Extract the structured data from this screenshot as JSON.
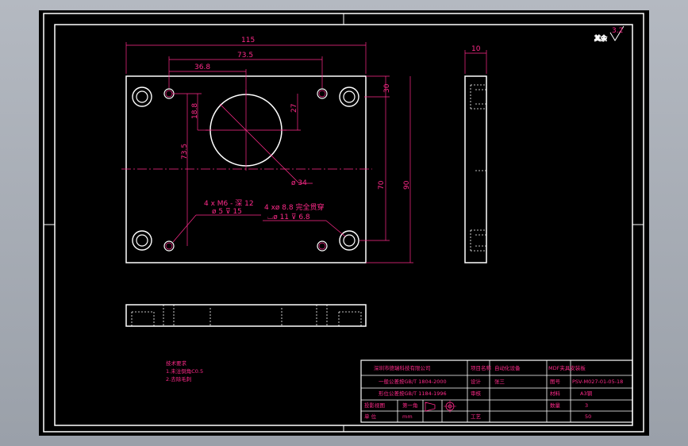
{
  "drawing": {
    "dims": {
      "d115": "115",
      "d735": "73.5",
      "d368": "36.8",
      "d30": "30",
      "d27": "27",
      "d188": "18.8",
      "d735v": "73.5",
      "d70": "70",
      "d90": "90",
      "d10": "10",
      "phi34": "ø 34"
    },
    "callouts": {
      "thread_a": "4 x  M6 - 深 12",
      "thread_b": "ø 5 ⊽ 15",
      "cbore_a": "4 xø  8.8 完全贯穿",
      "cbore_b": "⌴ø 11 ⊽ 6.8"
    },
    "roughness": {
      "label": "其余",
      "value": "3.2"
    },
    "notes": {
      "title": "技术要求",
      "line1": "1.未注倒角C0.5",
      "line2": "2.去除毛刺"
    },
    "titleblock": {
      "company": "深圳市德瑞科技有限公司",
      "tol1": "一般公差按GB/T 1804-2000",
      "tol2": "形位公差按GB/T 1184-1996",
      "projection": "投影视图",
      "sheet": "第一角",
      "unit": "单 位",
      "unit_val": "mm",
      "project_label": "项目名称",
      "project_val": "自动化设备",
      "designer_label": "设计",
      "designer_val": "张三",
      "check_label": "审核",
      "craft_label": "工艺",
      "name_val": "MDF夹具安装板",
      "drawno_label": "图号",
      "drawno_val": "PSV-M027-01-05-18",
      "material_label": "材料",
      "material_val": "A3钢",
      "qty_label": "数量",
      "qty_val": "3",
      "weight_val": "50"
    }
  }
}
